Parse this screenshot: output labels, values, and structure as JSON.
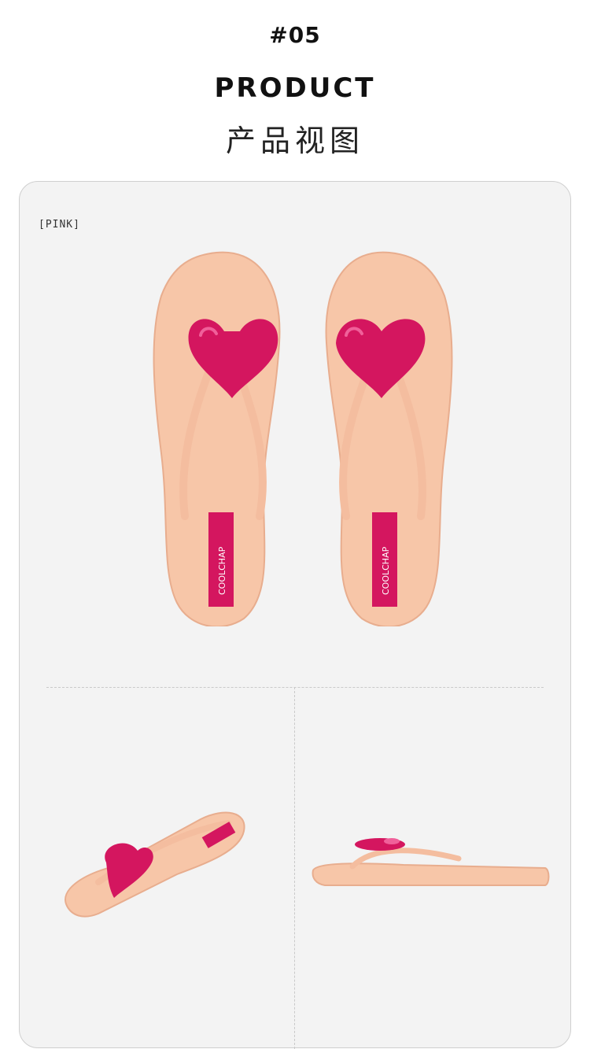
{
  "header": {
    "section_number": "#05",
    "title_en": "PRODUCT",
    "title_cn": "产品视图"
  },
  "panel": {
    "color_tag": "[PINK]"
  },
  "product": {
    "brand_label": "COOLCHAP",
    "colors": {
      "sole": "#f7c6a8",
      "sole_edge": "#e8ad8e",
      "strap": "#f4bd9f",
      "heart": "#d4165f",
      "heart_highlight": "#f0609a",
      "label_bg": "#d4165f",
      "label_text": "#ffffff"
    }
  }
}
